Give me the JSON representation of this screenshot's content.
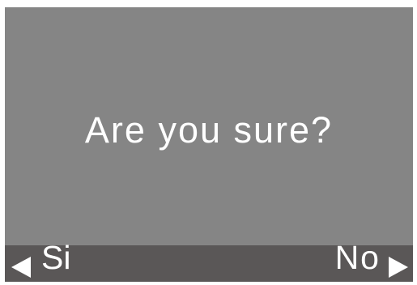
{
  "dialog": {
    "message": "Are you sure?"
  },
  "softkeys": {
    "left": {
      "label": "Si",
      "icon": "left-triangle-icon"
    },
    "right": {
      "label": "No",
      "icon": "right-triangle-icon"
    }
  },
  "colors": {
    "screen_background": "#858585",
    "softkey_bar_background": "#5a5757",
    "text": "#ffffff"
  }
}
